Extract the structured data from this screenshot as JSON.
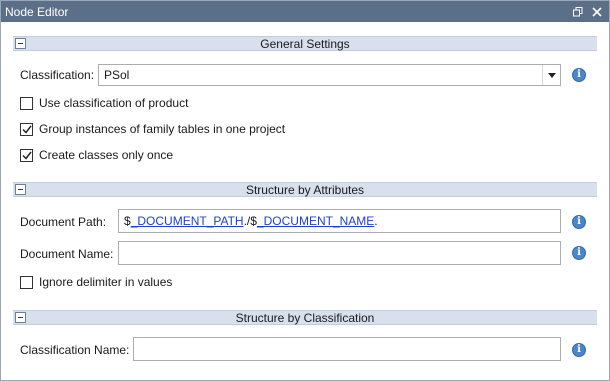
{
  "window": {
    "title": "Node Editor"
  },
  "sections": {
    "general": {
      "title": "General Settings"
    },
    "attributes": {
      "title": "Structure by Attributes"
    },
    "classification": {
      "title": "Structure by Classification"
    }
  },
  "general": {
    "classification_label": "Classification:",
    "classification_value": "PSol",
    "checkboxes": [
      {
        "label": "Use classification of product",
        "checked": false
      },
      {
        "label": "Group instances of family tables in one project",
        "checked": true
      },
      {
        "label": "Create classes only once",
        "checked": true
      }
    ]
  },
  "attributes": {
    "document_path_label": "Document Path:",
    "document_path_parts": {
      "p1": "$",
      "p2": "_DOCUMENT_PATH",
      "p3": "./$",
      "p4": "_DOCUMENT_NAME",
      "p5": "."
    },
    "document_name_label": "Document Name:",
    "document_name_value": "",
    "ignore_delimiter_label": "Ignore delimiter in values",
    "ignore_delimiter_checked": false
  },
  "classification": {
    "classification_name_label": "Classification Name:",
    "classification_name_value": ""
  },
  "icons": {
    "info": "info-icon",
    "restore": "restore-icon",
    "close": "close-icon",
    "collapse": "collapse-icon",
    "dropdown": "chevron-down-icon"
  },
  "colors": {
    "titlebar": "#5b6f89",
    "section_header": "#d7e0ec",
    "info_icon": "#4a86c8",
    "link": "#1f3fd0"
  }
}
